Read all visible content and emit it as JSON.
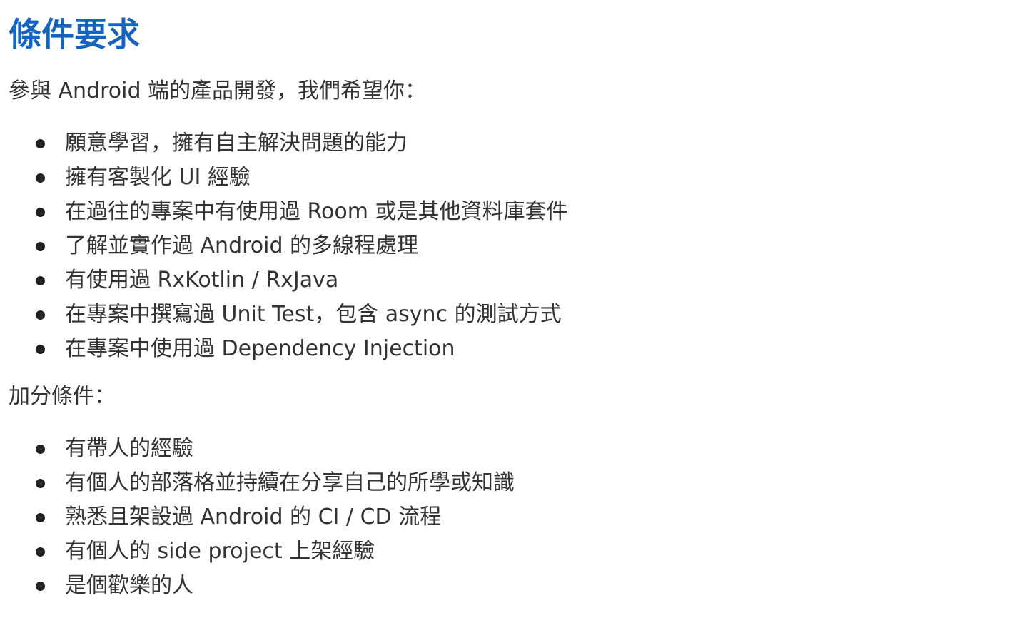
{
  "section": {
    "title": "條件要求",
    "intro": "參與 Android 端的產品開發，我們希望你：",
    "requirements": [
      "願意學習，擁有自主解決問題的能力",
      "擁有客製化 UI 經驗",
      "在過往的專案中有使用過 Room 或是其他資料庫套件",
      "了解並實作過 Android 的多線程處理",
      "有使用過 RxKotlin / RxJava",
      "在專案中撰寫過 Unit Test，包含 async 的測試方式",
      "在專案中使用過 Dependency Injection"
    ],
    "bonus_label": "加分條件：",
    "bonus": [
      "有帶人的經驗",
      "有個人的部落格並持續在分享自己的所學或知識",
      "熟悉且架設過 Android 的 CI / CD 流程",
      "有個人的 side project 上架經驗",
      "是個歡樂的人"
    ]
  },
  "colors": {
    "title": "#1565c0",
    "text": "#333333",
    "bullet": "#222222"
  },
  "icons": {
    "bullet": "filled-circle"
  }
}
